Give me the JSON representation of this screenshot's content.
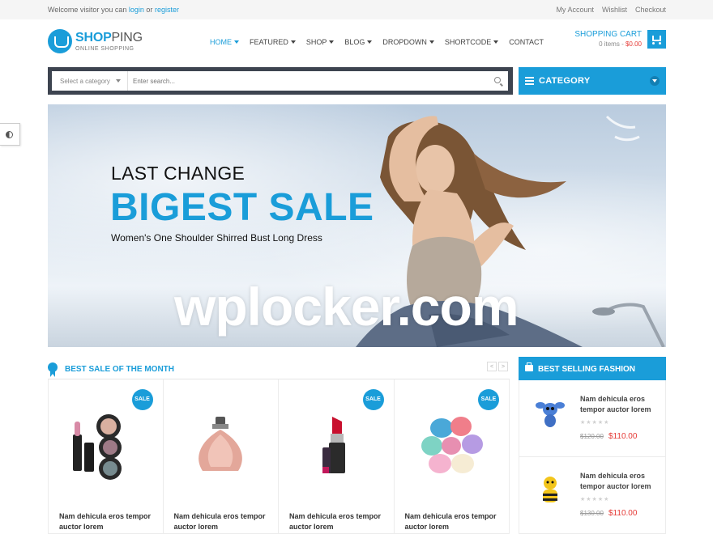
{
  "topbar": {
    "welcome_prefix": "Welcome visitor you can",
    "login": "login",
    "or": "or",
    "register": "register",
    "links": [
      "My Account",
      "Wishlist",
      "Checkout"
    ]
  },
  "logo": {
    "brand_bold": "SHOP",
    "brand_light": "PING",
    "tagline": "ONLINE SHOPPING"
  },
  "nav": {
    "items": [
      {
        "label": "HOME",
        "dropdown": true,
        "active": true
      },
      {
        "label": "FEATURED",
        "dropdown": true
      },
      {
        "label": "SHOP",
        "dropdown": true
      },
      {
        "label": "BLOG",
        "dropdown": true
      },
      {
        "label": "DROPDOWN",
        "dropdown": true
      },
      {
        "label": "SHORTCODE",
        "dropdown": true
      },
      {
        "label": "CONTACT",
        "dropdown": false
      }
    ]
  },
  "cart": {
    "title": "SHOPPING CART",
    "items": "0 items -",
    "total": "$0.00"
  },
  "search": {
    "category": "Select a category",
    "placeholder": "Enter search..."
  },
  "category": {
    "label": "CATEGORY"
  },
  "hero": {
    "kicker": "LAST CHANGE",
    "headline": "BIGEST SALE",
    "subline": "Women's One Shoulder Shirred Bust Long Dress",
    "watermark": "wplocker.com"
  },
  "best_sale": {
    "title": "BEST SALE OF THE MONTH",
    "prev": "<",
    "next": ">",
    "products": [
      {
        "name": "Nam dehicula eros tempor auctor lorem",
        "badge": "SALE",
        "image": "makeup-set"
      },
      {
        "name": "Nam dehicula eros tempor auctor lorem",
        "badge": "",
        "image": "perfume-bottle"
      },
      {
        "name": "Nam dehicula eros tempor auctor lorem",
        "badge": "SALE",
        "image": "lipstick"
      },
      {
        "name": "Nam dehicula eros tempor auctor lorem",
        "badge": "SALE",
        "image": "makeup-sponges"
      }
    ]
  },
  "best_selling": {
    "title": "BEST SELLING FASHION",
    "items": [
      {
        "name": "Nam dehicula eros tempor auctor lorem",
        "old_price": "$120.00",
        "price": "$110.00",
        "image": "blue-plush-toy",
        "rating": 0
      },
      {
        "name": "Nam dehicula eros tempor auctor lorem",
        "old_price": "$130.00",
        "price": "$110.00",
        "image": "bee-plush-toy",
        "rating": 0
      }
    ]
  },
  "colors": {
    "accent": "#1a9dd9",
    "dark": "#3d4450",
    "price": "#e53935"
  }
}
